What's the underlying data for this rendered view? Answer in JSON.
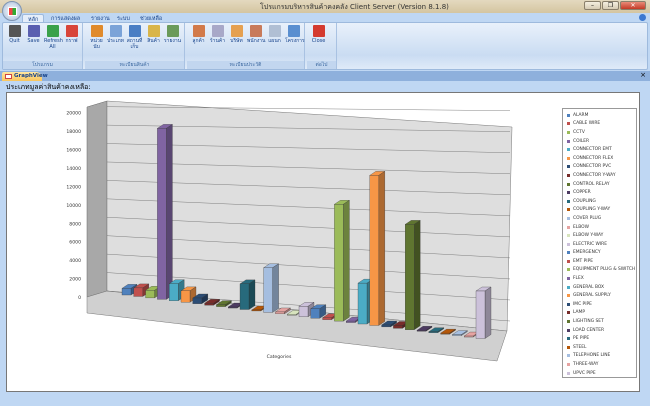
{
  "window": {
    "title": "โปรแกรมบริหารสินค้าคงคลัง Client Server (Version 8.1.8)",
    "minimize": "–",
    "restore": "❐",
    "close": "✕"
  },
  "tabs": [
    "หลัก",
    "การแสดงผล",
    "รายงาน",
    "ระบบ",
    "ช่วยเหลือ"
  ],
  "groups": [
    {
      "label": "โปรแกรม",
      "buttons": [
        {
          "label": "Quit",
          "icon": "close-x-icon",
          "color": "#555555"
        },
        {
          "label": "Save",
          "icon": "save-icon",
          "color": "#5a5fb0"
        },
        {
          "label": "Refresh All",
          "icon": "refresh-icon",
          "color": "#3aa14a"
        },
        {
          "label": "กราฟ",
          "icon": "chart-icon",
          "color": "#d8453a"
        }
      ]
    },
    {
      "label": "ทะเบียนสินค้า",
      "buttons": [
        {
          "label": "หน่วยนับ",
          "icon": "units-icon",
          "color": "#e08a2b"
        },
        {
          "label": "ประเภท",
          "icon": "category-icon",
          "color": "#7ba3d8"
        },
        {
          "label": "สถานที่เก็บ",
          "icon": "warehouse-icon",
          "color": "#4a7ec4"
        },
        {
          "label": "สินค้า",
          "icon": "product-icon",
          "color": "#d9b54a"
        },
        {
          "label": "รายงาน",
          "icon": "report-icon",
          "color": "#6a9a5a"
        }
      ]
    },
    {
      "label": "ทะเบียนประวัติ",
      "buttons": [
        {
          "label": "ลูกค้า",
          "icon": "customer-icon",
          "color": "#d27a4a"
        },
        {
          "label": "ร้านค้า",
          "icon": "store-icon",
          "color": "#a8a8c8"
        },
        {
          "label": "บริษัท",
          "icon": "company-icon",
          "color": "#e5a050"
        },
        {
          "label": "พนักงาน",
          "icon": "employee-icon",
          "color": "#c87a5a"
        },
        {
          "label": "แผนก",
          "icon": "department-icon",
          "color": "#b0bfd4"
        },
        {
          "label": "โครงการ",
          "icon": "project-icon",
          "color": "#5a8fd0"
        }
      ]
    },
    {
      "label": "ต่อไป",
      "buttons": [
        {
          "label": "Close",
          "icon": "close-icon",
          "color": "#d43a2f"
        }
      ]
    }
  ],
  "doc_tab": {
    "label": "GraphView",
    "close": "×"
  },
  "heading": "ประเภทมูลค่าสินค้าคงเหลือ:",
  "chart_data": {
    "type": "bar",
    "subtype": "3d-clustered",
    "title": "",
    "xlabel": "Categories",
    "ylabel": "",
    "ylim": [
      0,
      20000
    ],
    "yticks": [
      0,
      2000,
      4000,
      6000,
      8000,
      10000,
      12000,
      14000,
      16000,
      18000,
      20000
    ],
    "legend_position": "right",
    "series": [
      {
        "name": "ALARM",
        "color": "#4f81bd",
        "value": 700
      },
      {
        "name": "CABLE WIRE",
        "color": "#c0504d",
        "value": 900
      },
      {
        "name": "CCTV",
        "color": "#9bbb59",
        "value": 800
      },
      {
        "name": "COILER",
        "color": "#8064a2",
        "value": 18000
      },
      {
        "name": "CONNECTOR EMT",
        "color": "#4bacc6",
        "value": 1800
      },
      {
        "name": "CONNECTOR FLEX",
        "color": "#f79646",
        "value": 1200
      },
      {
        "name": "CONNECTOR PVC",
        "color": "#2c4d75",
        "value": 600
      },
      {
        "name": "CONNECTOR Y-WAY",
        "color": "#772c2a",
        "value": 200
      },
      {
        "name": "CONTROL RELAY",
        "color": "#5f7530",
        "value": 200
      },
      {
        "name": "COPPER",
        "color": "#4d3b62",
        "value": 100
      },
      {
        "name": "COUPLING",
        "color": "#276a7c",
        "value": 2700
      },
      {
        "name": "COUPLING Y-WAY",
        "color": "#b65708",
        "value": 100
      },
      {
        "name": "COVER PLUG",
        "color": "#a5bee0",
        "value": 4700
      },
      {
        "name": "ELBOW",
        "color": "#e6a3a1",
        "value": 200
      },
      {
        "name": "ELBOW Y-WAY",
        "color": "#d7e4bd",
        "value": 100
      },
      {
        "name": "ELECTRIC WIRE",
        "color": "#ccc1da",
        "value": 1100
      },
      {
        "name": "EMERGENCY",
        "color": "#4f81bd",
        "value": 1000
      },
      {
        "name": "EMT PIPE",
        "color": "#c0504d",
        "value": 200
      },
      {
        "name": "EQUIPMENT PLUG & SWITCH",
        "color": "#9bbb59",
        "value": 12300
      },
      {
        "name": "FLEX",
        "color": "#8064a2",
        "value": 150
      },
      {
        "name": "GENERAL BOX",
        "color": "#4bacc6",
        "value": 4300
      },
      {
        "name": "GENERAL SUPPLY",
        "color": "#f79646",
        "value": 15800
      },
      {
        "name": "IMC PIPE",
        "color": "#2c4d75",
        "value": 200
      },
      {
        "name": "LAMP",
        "color": "#772c2a",
        "value": 300
      },
      {
        "name": "LIGHTING SET",
        "color": "#5f7530",
        "value": 11100
      },
      {
        "name": "LOAD CENTER",
        "color": "#4d3b62",
        "value": 100
      },
      {
        "name": "PE PIPE",
        "color": "#276a7c",
        "value": 100
      },
      {
        "name": "STEEL",
        "color": "#b65708",
        "value": 100
      },
      {
        "name": "TELEPHONE LINE",
        "color": "#a5bee0",
        "value": 100
      },
      {
        "name": "THREE-WAY",
        "color": "#e6a3a1",
        "value": 100
      },
      {
        "name": "UPVC PIPE",
        "color": "#ccc1da",
        "value": 5000
      }
    ]
  }
}
